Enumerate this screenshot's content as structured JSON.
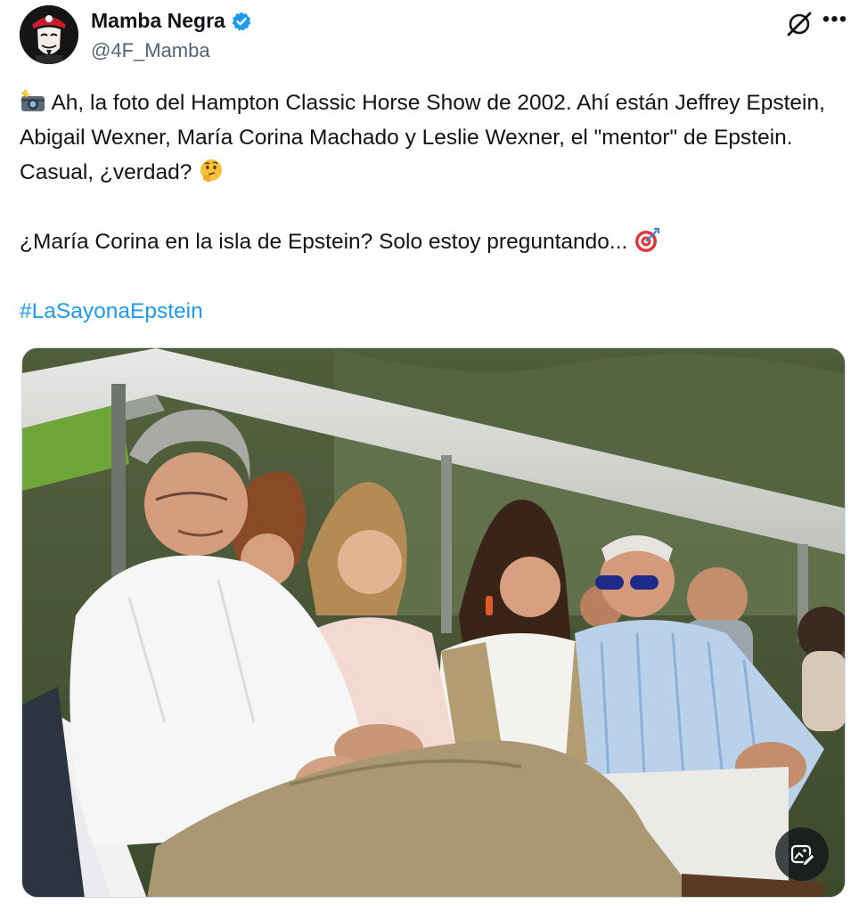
{
  "author": {
    "display_name": "Mamba Negra",
    "handle": "@4F_Mamba",
    "verified": true,
    "avatar_icon": "masked-face-avatar"
  },
  "header_icons": [
    "grok-icon",
    "more-icon"
  ],
  "tweet": {
    "line1_prefix_icon": "camera-flash-emoji",
    "paragraph1": "Ah, la foto del Hampton Classic Horse Show de 2002. Ahí están Jeffrey Epstein, Abigail Wexner, María Corina Machado y Leslie Wexner, el \"mentor\" de Epstein. Casual, ¿verdad?",
    "paragraph1_suffix_icon": "thinking-face-emoji",
    "paragraph2": "¿María Corina en la isla de Epstein? Solo estoy preguntando...",
    "paragraph2_suffix_icon": "direct-hit-emoji",
    "hashtag": "#LaSayonaEpstein"
  },
  "media": {
    "badge_icon": "image-edit-icon"
  },
  "colors": {
    "text": "#0f1419",
    "secondary": "#536471",
    "link": "#1d9bf0",
    "verified": "#1d9bf0"
  }
}
